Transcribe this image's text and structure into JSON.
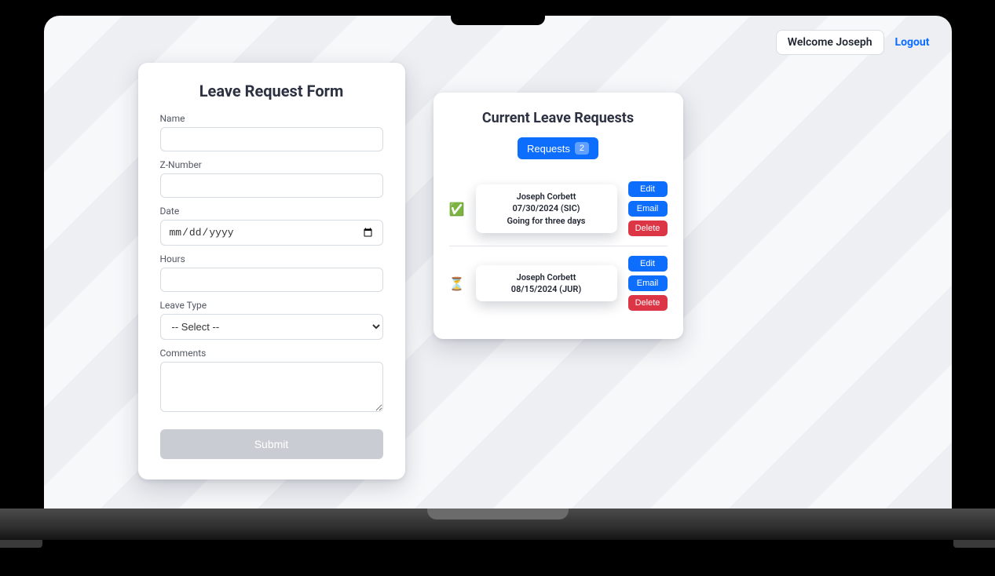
{
  "header": {
    "welcome_label": "Welcome Joseph",
    "logout_label": "Logout"
  },
  "form": {
    "title": "Leave Request Form",
    "labels": {
      "name": "Name",
      "znumber": "Z-Number",
      "date": "Date",
      "hours": "Hours",
      "leave_type": "Leave Type",
      "comments": "Comments"
    },
    "date_placeholder": "mm/dd/yyyy",
    "leave_type_selected": "-- Select --",
    "submit_label": "Submit"
  },
  "requests": {
    "title": "Current Leave Requests",
    "button_label": "Requests",
    "count": "2",
    "action_labels": {
      "edit": "Edit",
      "email": "Email",
      "delete": "Delete"
    },
    "items": [
      {
        "status_icon": "✅",
        "line1": "Joseph Corbett",
        "line2": "07/30/2024 (SIC)",
        "line3": "Going for three days"
      },
      {
        "status_icon": "⏳",
        "line1": "Joseph Corbett",
        "line2": "08/15/2024 (JUR)",
        "line3": ""
      }
    ]
  }
}
